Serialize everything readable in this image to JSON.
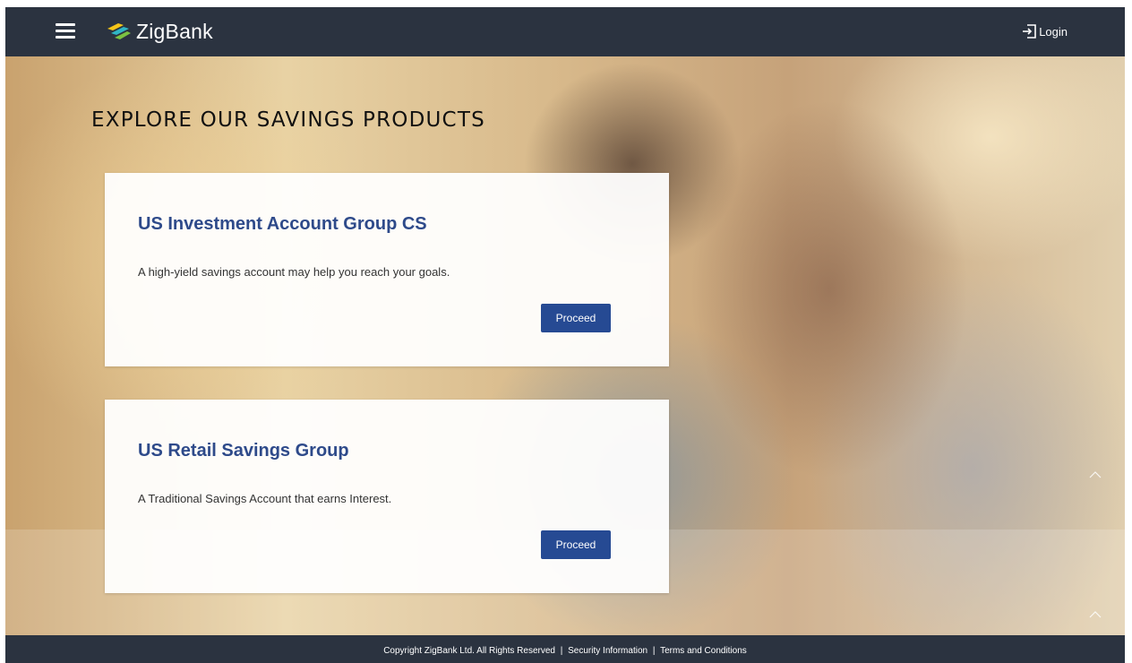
{
  "header": {
    "brand_name": "ZigBank",
    "login_label": "Login",
    "menu_icon": "hamburger-menu-icon",
    "login_icon": "login-arrow-icon",
    "bar_color": "#2b3340"
  },
  "main": {
    "title": "EXPLORE OUR SAVINGS PRODUCTS",
    "products": [
      {
        "name": "US Investment Account Group CS",
        "description": "A high-yield savings account may help you reach your goals.",
        "action_label": "Proceed"
      },
      {
        "name": "US Retail Savings Group",
        "description": "A Traditional Savings Account that earns Interest.",
        "action_label": "Proceed"
      }
    ],
    "accent_color": "#264a93",
    "title_color": "#2e4a8a"
  },
  "footer": {
    "copyright": "Copyright ZigBank Ltd. All Rights Reserved",
    "security_link": "Security Information",
    "terms_link": "Terms and Conditions",
    "separator": "|"
  }
}
